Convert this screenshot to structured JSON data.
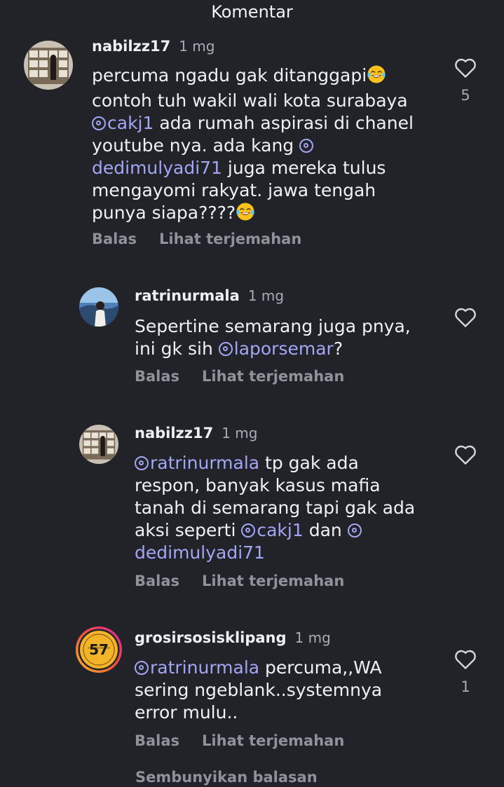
{
  "header": {
    "title": "Komentar"
  },
  "comments": [
    {
      "username": "nabilzz17",
      "time": "1 mg",
      "segments": [
        {
          "t": "percuma ngadu gak ditanggapi"
        },
        {
          "emoji": "joy"
        },
        {
          "t": " contoh tuh wakil wali kota surabaya "
        },
        {
          "m": "cakj1"
        },
        {
          "t": " ada rumah aspirasi di chanel youtube nya. ada kang "
        },
        {
          "m": "dedimulyadi71"
        },
        {
          "t": " juga mereka tulus mengayomi rakyat. jawa tengah punya siapa????"
        },
        {
          "emoji": "joy"
        }
      ],
      "reply_label": "Balas",
      "translate_label": "Lihat terjemahan",
      "likes": "5"
    },
    {
      "username": "ratrinurmala",
      "time": "1 mg",
      "segments": [
        {
          "t": "Sepertine semarang juga pnya, ini gk sih "
        },
        {
          "m": "laporsemar"
        },
        {
          "t": "?"
        }
      ],
      "reply_label": "Balas",
      "translate_label": "Lihat terjemahan",
      "likes": ""
    },
    {
      "username": "nabilzz17",
      "time": "1 mg",
      "segments": [
        {
          "m": "ratrinurmala"
        },
        {
          "t": " tp gak ada respon, banyak kasus mafia tanah di semarang tapi gak ada aksi seperti "
        },
        {
          "m": "cakj1"
        },
        {
          "t": " dan "
        },
        {
          "m": "dedimulyadi71"
        }
      ],
      "reply_label": "Balas",
      "translate_label": "Lihat terjemahan",
      "likes": ""
    },
    {
      "username": "grosirsosisklipang",
      "time": "1 mg",
      "segments": [
        {
          "m": "ratrinurmala"
        },
        {
          "t": " percuma,,WA sering ngeblank..systemnya error mulu.."
        }
      ],
      "reply_label": "Balas",
      "translate_label": "Lihat terjemahan",
      "likes": "1",
      "avatar_text": "57"
    }
  ],
  "footer": {
    "hide_replies": "Sembunyikan balasan"
  },
  "colors": {
    "background": "#212328",
    "mention": "#a3a6f5",
    "muted": "#8e939b",
    "story_ring_start": "#f9b82b",
    "story_ring_end": "#d6249f"
  },
  "icons": {
    "like": "heart-outline-icon",
    "emoji": "face-with-tears-of-joy-emoji"
  }
}
